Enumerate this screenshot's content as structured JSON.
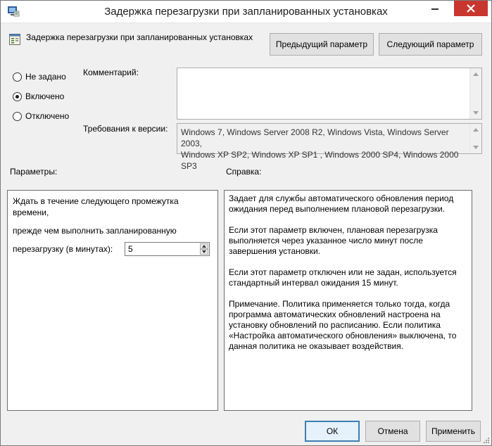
{
  "window": {
    "title": "Задержка перезагрузки при запланированных установках"
  },
  "header": {
    "policy_name": "Задержка перезагрузки при запланированных установках",
    "prev_button": "Предыдущий параметр",
    "next_button": "Следующий параметр"
  },
  "state": {
    "options": [
      {
        "label": "Не задано",
        "selected": false
      },
      {
        "label": "Включено",
        "selected": true
      },
      {
        "label": "Отключено",
        "selected": false
      }
    ]
  },
  "comment": {
    "label": "Комментарий:",
    "value": ""
  },
  "supported": {
    "label": "Требования к версии:",
    "line1": "Windows 7, Windows Server 2008 R2, Windows Vista, Windows Server 2003,",
    "line2": "Windows XP SP2, Windows XP SP1 , Windows 2000 SP4, Windows 2000 SP3"
  },
  "options_panel": {
    "label": "Параметры:",
    "line1": "Ждать в течение следующего промежутка",
    "line2": "времени,",
    "line3": "прежде чем выполнить запланированную",
    "field_label": "перезагрузку (в минутах):",
    "field_value": "5"
  },
  "help_panel": {
    "label": "Справка:",
    "p1": "Задает для службы автоматического обновления период ожидания перед выполнением плановой перезагрузки.",
    "p2": "Если этот параметр включен, плановая перезагрузка выполняется через указанное число минут после завершения установки.",
    "p3": "Если этот параметр отключен или не задан, используется стандартный интервал ожидания 15 минут.",
    "p4": "Примечание. Политика применяется только тогда, когда программа автоматических обновлений настроена на установку обновлений по расписанию. Если политика «Настройка автоматического обновления» выключена, то данная политика не оказывает воздействия."
  },
  "footer": {
    "ok": "ОК",
    "cancel": "Отмена",
    "apply": "Применить"
  },
  "icons": {
    "app": "group-policy-icon",
    "policy": "policy-setting-icon",
    "minimize": "minimize-icon",
    "close": "close-icon"
  }
}
